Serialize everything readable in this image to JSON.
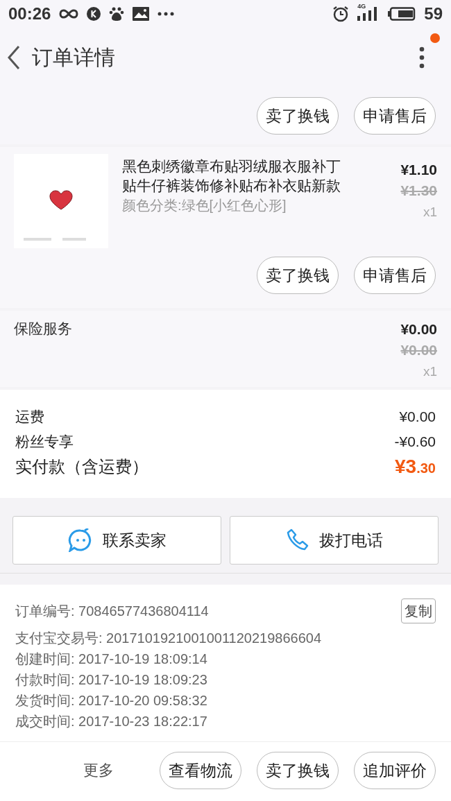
{
  "status_bar": {
    "time": "00:26",
    "network": "4G",
    "battery": "59"
  },
  "header": {
    "title": "订单详情",
    "has_notification": true
  },
  "top_actions": [
    "卖了换钱",
    "申请售后"
  ],
  "product": {
    "title": "黑色刺绣徽章布贴羽绒服衣服补丁贴牛仔裤装饰修补贴布补衣贴新款",
    "variant": "颜色分类:绿色[小红色心形]",
    "price": "¥1.10",
    "original_price": "¥1.30",
    "quantity": "x1",
    "actions": [
      "卖了换钱",
      "申请售后"
    ]
  },
  "insurance": {
    "label": "保险服务",
    "price": "¥0.00",
    "original_price": "¥0.00",
    "quantity": "x1"
  },
  "totals": [
    {
      "label": "运费",
      "value": "¥0.00",
      "kind": "plain"
    },
    {
      "label": "粉丝专享",
      "value": "-¥0.60",
      "kind": "plain"
    },
    {
      "label": "实付款（含运费）",
      "value": "¥3",
      "value_small": ".30",
      "kind": "total"
    }
  ],
  "contact": [
    {
      "label": "联系卖家",
      "kind": "chat"
    },
    {
      "label": "拨打电话",
      "kind": "phone"
    }
  ],
  "order_info": {
    "copy": "复制",
    "lines": [
      "订单编号: 70846577436804114",
      "支付宝交易号: 2017101921001001120219866604",
      "创建时间: 2017-10-19 18:09:14",
      "付款时间: 2017-10-19 18:09:23",
      "发货时间: 2017-10-20 09:58:32",
      "成交时间: 2017-10-23 18:22:17"
    ]
  },
  "bottom_bar": {
    "more": "更多",
    "buttons": [
      "查看物流",
      "卖了换钱",
      "追加评价"
    ]
  }
}
